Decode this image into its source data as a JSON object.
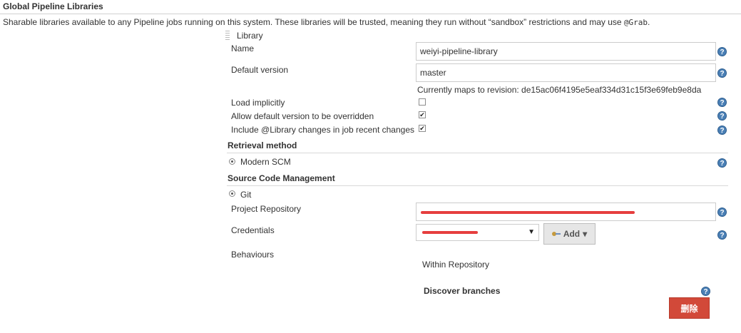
{
  "section": {
    "title": "Global Pipeline Libraries",
    "description": "Sharable libraries available to any Pipeline jobs running on this system. These libraries will be trusted, meaning they run without “sandbox” restrictions and may use",
    "description_code": "@Grab",
    "description_end": "."
  },
  "library": {
    "header": "Library",
    "name_label": "Name",
    "name_value": "weiyi-pipeline-library",
    "default_version_label": "Default version",
    "default_version_value": "master",
    "revision_note": "Currently maps to revision: de15ac06f4195e5eaf334d31c15f3e69feb9e8da",
    "load_implicitly_label": "Load implicitly",
    "load_implicitly_checked": false,
    "allow_override_label": "Allow default version to be overridden",
    "allow_override_checked": true,
    "include_changes_label": "Include @Library changes in job recent changes",
    "include_changes_checked": true
  },
  "retrieval": {
    "title": "Retrieval method",
    "option": "Modern SCM"
  },
  "scm": {
    "title": "Source Code Management",
    "option": "Git",
    "project_repo_label": "Project Repository",
    "credentials_label": "Credentials",
    "credentials_value": "",
    "add_label": "Add",
    "behaviours_label": "Behaviours",
    "within_repository": "Within Repository",
    "discover_branches": "Discover branches",
    "delete_label": "删除"
  },
  "icons": {
    "help": "help-icon",
    "check": "✔",
    "dropdown": "▼",
    "caret": "▾"
  },
  "colors": {
    "help_blue": "#4a7fb5",
    "delete_red": "#d24939",
    "redaction_red": "#e63e3e"
  }
}
